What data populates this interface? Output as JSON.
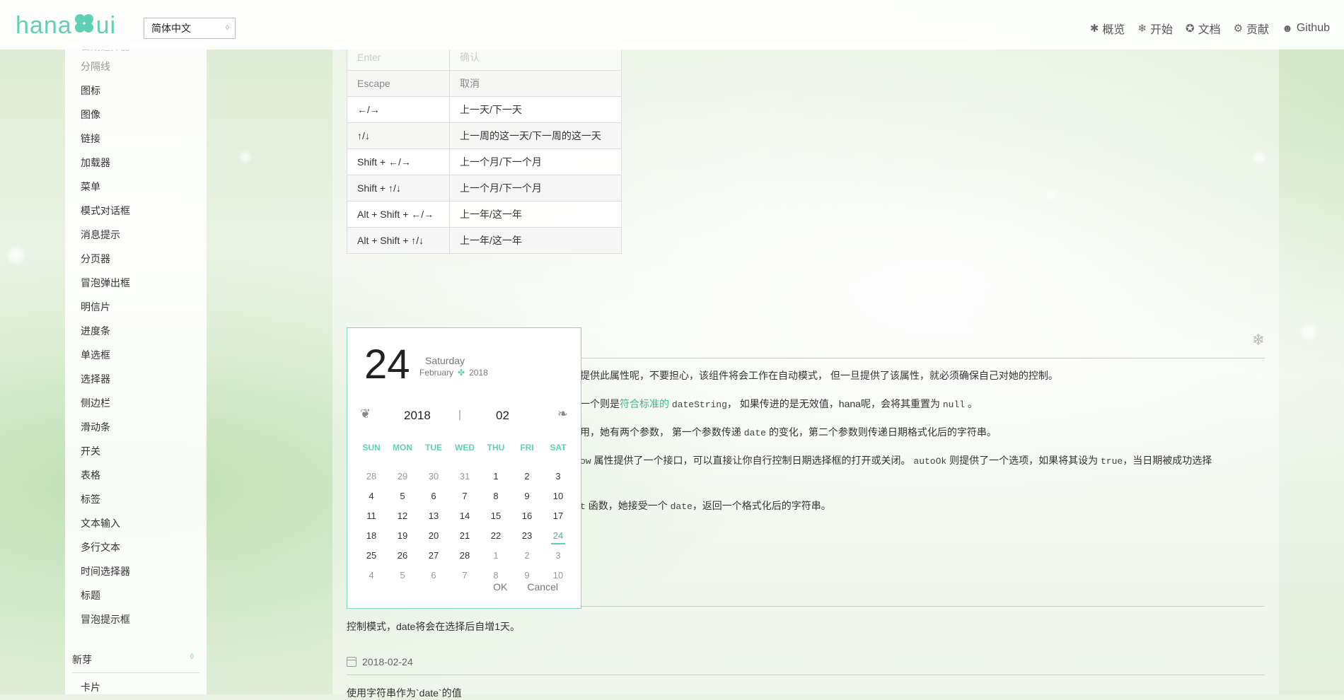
{
  "header": {
    "logo_text_left": "hana",
    "logo_text_right": "ui",
    "language": "简体中文",
    "nav": [
      "概览",
      "开始",
      "文档",
      "贡献",
      "Github"
    ]
  },
  "sidebar": {
    "items_top": [
      "分隔线",
      "图标",
      "图像",
      "链接",
      "加载器",
      "菜单",
      "模式对话框",
      "消息提示",
      "分页器",
      "冒泡弹出框",
      "明信片",
      "进度条",
      "单选框",
      "选择器",
      "侧边栏",
      "滑动条",
      "开关",
      "表格",
      "标签",
      "文本输入",
      "多行文本",
      "时间选择器",
      "标题",
      "冒泡提示框"
    ],
    "group_label": "新芽",
    "items_bottom": [
      "卡片"
    ]
  },
  "keyboard_table": {
    "rows": [
      {
        "key": "Enter",
        "value": "确认"
      },
      {
        "key": "Escape",
        "value": "取消"
      },
      {
        "key": "←/→",
        "value": "上一天/下一天"
      },
      {
        "key": "↑/↓",
        "value": "上一周的这一天/下一周的这一天"
      },
      {
        "key": "Shift + ←/→",
        "value": "上一个月/下一个月"
      },
      {
        "key": "Shift + ↑/↓",
        "value": "上一个月/下一个月"
      },
      {
        "key": "Alt + Shift + ←/→",
        "value": "上一年/这一年"
      },
      {
        "key": "Alt + Shift + ↑/↓",
        "value": "上一年/这一年"
      }
    ]
  },
  "desc": {
    "line1": "提供此属性呢，不要担心，该组件将会工作在自动模式， 但一旦提供了该属性，就必须确保自己对她的控制。",
    "line2_pre": "一个则是",
    "line2_hl": "符合标准的",
    "line2_code": "dateString",
    "line2_mid": "， 如果传进的是无效值，hana呢，会将其重置为",
    "line2_code2": "null",
    "line2_end": "。",
    "line3_pre": "用，她有两个参数， 第一个参数传递",
    "line3_code": "date",
    "line3_post": "的变化，第二个参数则传递日期格式化后的字符串。",
    "line4_code": "ow",
    "line4_mid": "属性提供了一个接口，可以直接让你自行控制日期选择框的打开或关闭。",
    "line4_code2": "autoOk",
    "line4_mid2": "则提供了一个选项，如果将其设为",
    "line4_code3": "true",
    "line4_end": "，当日期被成功选择",
    "line5_code": "t",
    "line5_mid": "函数，她接受一个",
    "line5_code2": "date",
    "line5_end": "，返回一个格式化后的字符串。"
  },
  "para_controlled": "控制模式，date将会在选择后自增1天。",
  "date_value": "2018-02-24",
  "para_string": "使用字符串作为`date`的值",
  "date_picker": {
    "big_day": "24",
    "weekday": "Saturday",
    "month": "February",
    "year_small": "2018",
    "year": "2018",
    "separator": "|",
    "month_num": "02",
    "weekdays": [
      "SUN",
      "MON",
      "TUE",
      "WED",
      "THU",
      "FRI",
      "SAT"
    ],
    "days": [
      [
        "28",
        "29",
        "30",
        "31",
        "1",
        "2",
        "3"
      ],
      [
        "4",
        "5",
        "6",
        "7",
        "8",
        "9",
        "10"
      ],
      [
        "11",
        "12",
        "13",
        "14",
        "15",
        "16",
        "17"
      ],
      [
        "18",
        "19",
        "20",
        "21",
        "22",
        "23",
        "24"
      ],
      [
        "25",
        "26",
        "27",
        "28",
        "1",
        "2",
        "3"
      ],
      [
        "4",
        "5",
        "6",
        "7",
        "8",
        "9",
        "10"
      ]
    ],
    "selected": "24",
    "ok_label": "OK",
    "cancel_label": "Cancel"
  },
  "colors": {
    "accent": "#5fd0b3",
    "border": "#7ed9bf"
  }
}
